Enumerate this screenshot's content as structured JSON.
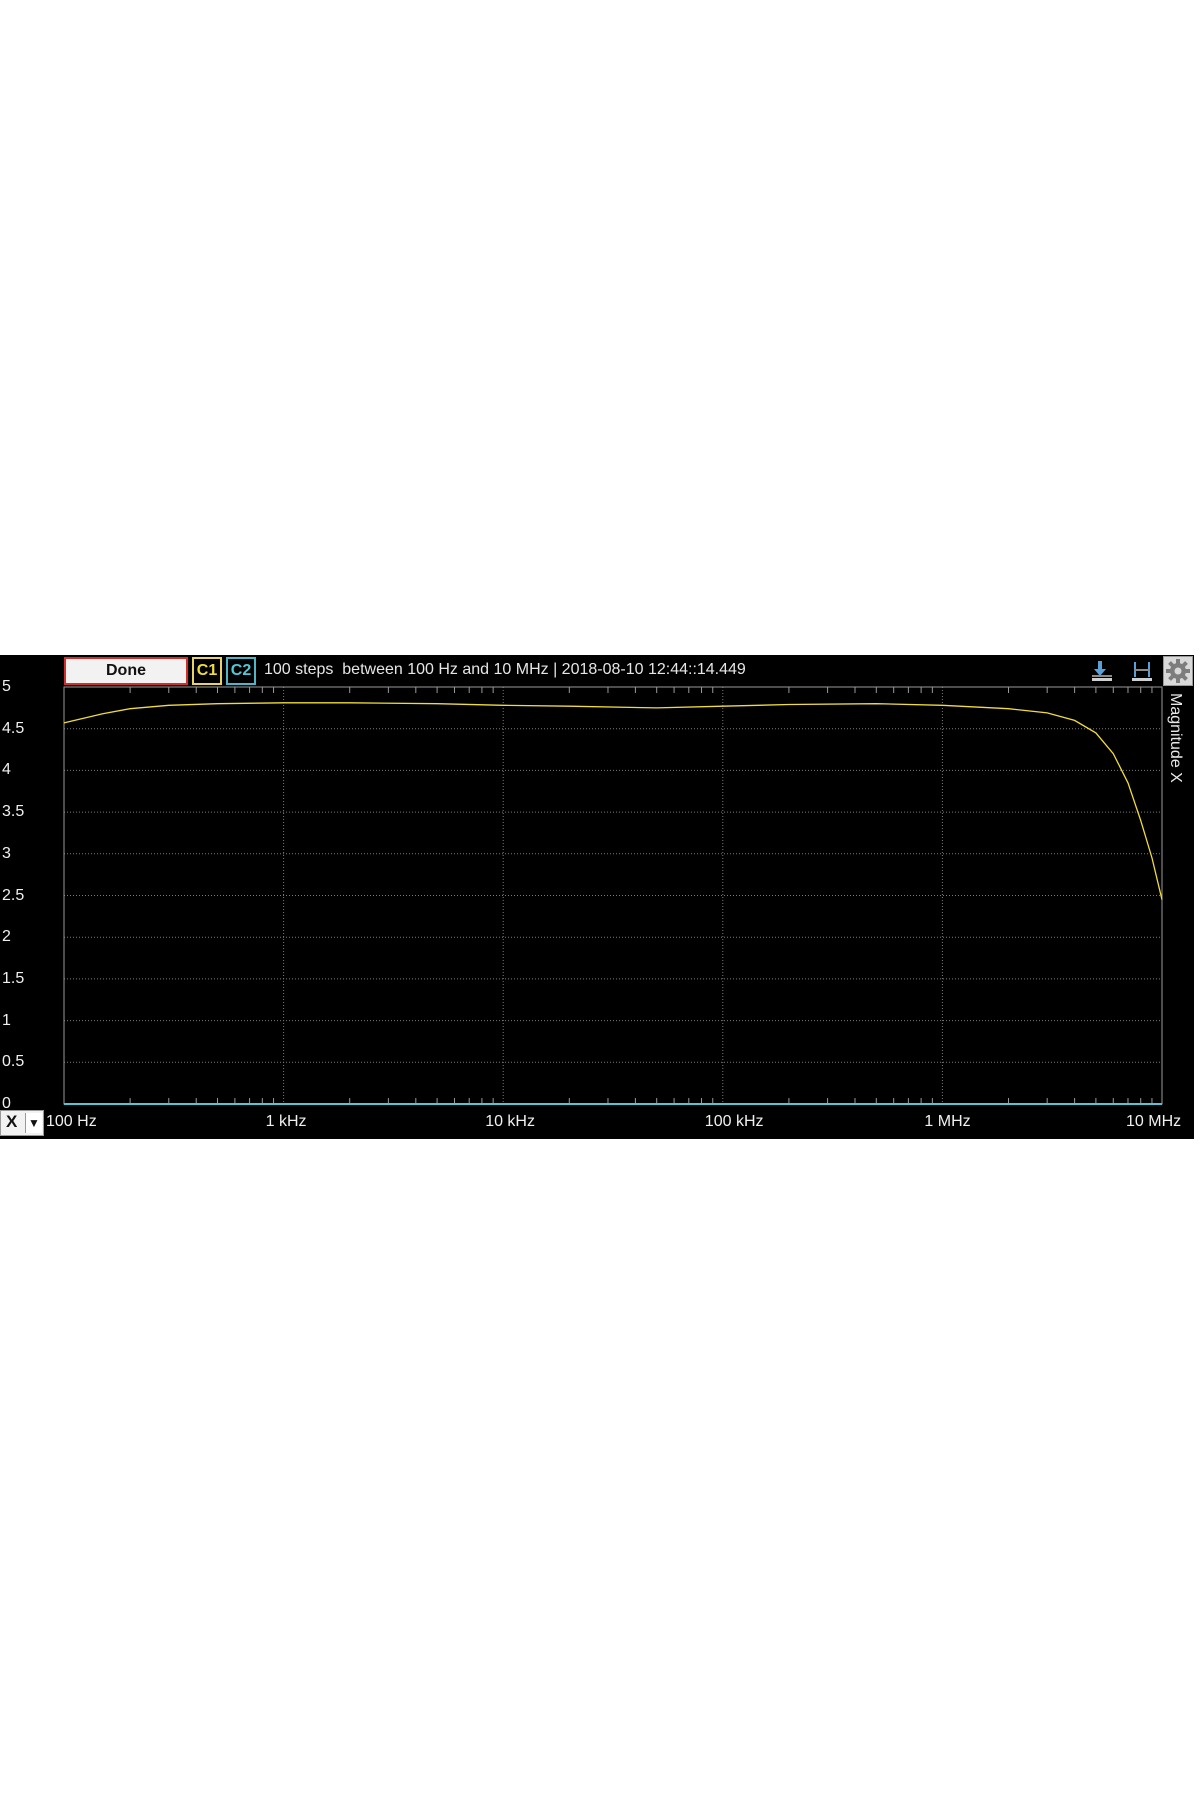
{
  "toolbar": {
    "done_label": "Done",
    "channel_1_label": "C1",
    "channel_2_label": "C2",
    "status_text": "100 steps  between 100 Hz and 10 MHz | 2018-08-10 12:44::14.449",
    "icons": [
      "cursor-download-icon",
      "cursor-baseline-icon",
      "gear-icon"
    ]
  },
  "axis_select": {
    "label": "X",
    "icon": "chevron-down-icon"
  },
  "colors": {
    "background": "#000000",
    "grid": "#7a7a7a",
    "channel_1": "#f0dc3c",
    "channel_2": "#53c6d8",
    "done_border": "#d0302c"
  },
  "chart_data": {
    "type": "line",
    "title": "",
    "xlabel": "",
    "ylabel": "Magnitude X",
    "x_scale": "log",
    "xlim": [
      100,
      10000000
    ],
    "ylim": [
      0,
      5
    ],
    "x_tick_labels": [
      "100 Hz",
      "1 kHz",
      "10 kHz",
      "100 kHz",
      "1 MHz",
      "10 MHz"
    ],
    "y_tick_labels": [
      "5",
      "4.5",
      "4",
      "3.5",
      "3",
      "2.5",
      "2",
      "1.5",
      "1",
      "0.5",
      "0"
    ],
    "grid": true,
    "series": [
      {
        "channel": "C1",
        "color": "#f0dc3c",
        "x": [
          100,
          150,
          200,
          300,
          500,
          1000,
          2000,
          5000,
          10000,
          20000,
          50000,
          100000,
          200000,
          500000,
          1000000,
          2000000,
          3000000,
          4000000,
          5000000,
          6000000,
          7000000,
          8000000,
          9000000,
          10000000
        ],
        "y": [
          4.57,
          4.68,
          4.74,
          4.78,
          4.8,
          4.81,
          4.81,
          4.8,
          4.78,
          4.77,
          4.75,
          4.77,
          4.79,
          4.8,
          4.78,
          4.74,
          4.69,
          4.6,
          4.45,
          4.2,
          3.85,
          3.4,
          2.95,
          2.45
        ]
      },
      {
        "channel": "C2",
        "color": "#53c6d8",
        "x": [
          100,
          10000000
        ],
        "y": [
          0,
          0
        ]
      }
    ]
  }
}
